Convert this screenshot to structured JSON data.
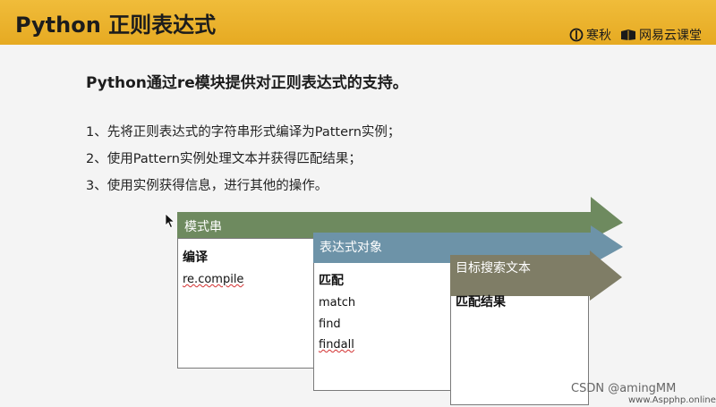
{
  "header": {
    "title": "Python 正则表达式",
    "brand_left": "寒秋",
    "brand_right": "网易云课堂"
  },
  "subtitle": "Python通过re模块提供对正则表达式的支持。",
  "steps": [
    "1、先将正则表达式的字符串形式编译为Pattern实例；",
    "2、使用Pattern实例处理文本并获得匹配结果；",
    "3、使用实例获得信息，进行其他的操作。"
  ],
  "diagram": {
    "stage1": {
      "label": "模式串",
      "color": "#6e8a5f",
      "head": "编译",
      "items": [
        "re.compile"
      ]
    },
    "stage2": {
      "label": "表达式对象",
      "color": "#6d93a8",
      "head": "匹配",
      "items": [
        "match",
        "find",
        "findall"
      ]
    },
    "stage3": {
      "label": "目标搜索文本",
      "color": "#7f7d66",
      "head": "匹配结果",
      "items": []
    }
  },
  "watermark": {
    "csdn": "CSDN @amingMM",
    "site": "www.Aspphp.online"
  }
}
